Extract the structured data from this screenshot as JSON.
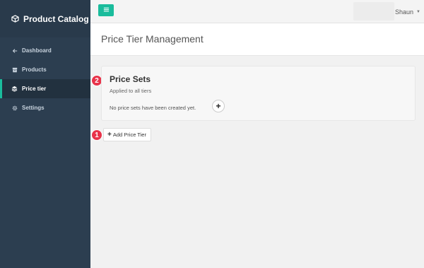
{
  "app": {
    "brand": "Product Catalog",
    "brand_icon": "cube-icon"
  },
  "sidebar": {
    "items": [
      {
        "label": "Dashboard",
        "icon": "arrow-left-icon",
        "active": false
      },
      {
        "label": "Products",
        "icon": "archive-icon",
        "active": false
      },
      {
        "label": "Price tier",
        "icon": "layers-icon",
        "active": true
      },
      {
        "label": "Settings",
        "icon": "gear-icon",
        "active": false
      }
    ]
  },
  "topbar": {
    "menu_icon": "hamburger-icon",
    "user_name": "Shaun"
  },
  "page": {
    "title": "Price Tier Management"
  },
  "price_sets": {
    "title": "Price Sets",
    "subtitle": "Applied to all tiers",
    "empty_text": "No price sets have been created yet.",
    "add_symbol": "+"
  },
  "add_tier": {
    "symbol": "+",
    "label": "Add Price Tier"
  },
  "badges": {
    "one": "1",
    "two": "2"
  },
  "colors": {
    "sidebar_bg": "#2c3e50",
    "accent": "#1abc9c",
    "badge": "#e8334a"
  }
}
